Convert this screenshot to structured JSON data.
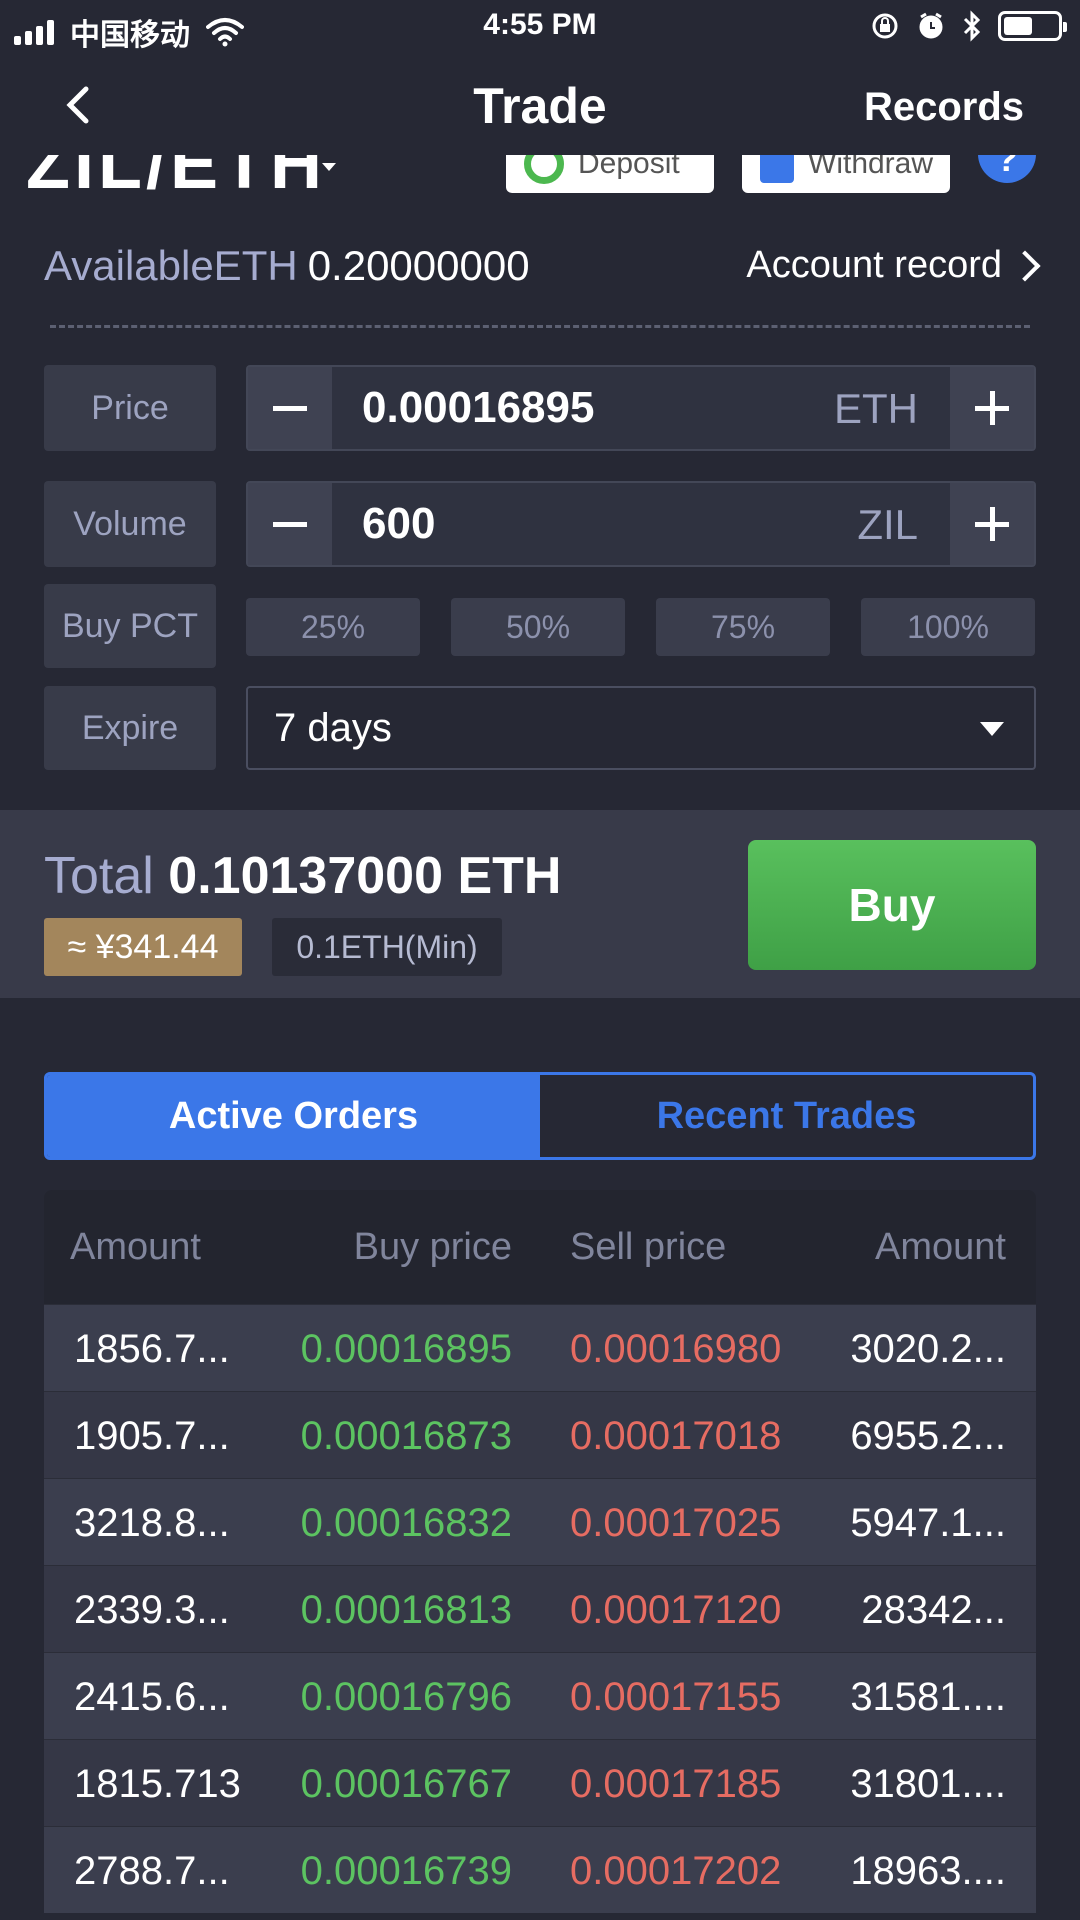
{
  "status_bar": {
    "carrier": "中国移动",
    "time": "4:55 PM"
  },
  "nav": {
    "title": "Trade",
    "records": "Records"
  },
  "pair": {
    "name": "ZIL/ETH",
    "deposit": "Deposit",
    "withdraw": "Withdraw",
    "help": "?"
  },
  "available": {
    "label": "AvailableETH",
    "value": "0.20000000",
    "account_record": "Account record"
  },
  "form": {
    "price": {
      "label": "Price",
      "value": "0.00016895",
      "unit": "ETH"
    },
    "volume": {
      "label": "Volume",
      "value": "600",
      "unit": "ZIL"
    },
    "buy_pct": {
      "label": "Buy PCT",
      "options": [
        "25%",
        "50%",
        "75%",
        "100%"
      ]
    },
    "expire": {
      "label": "Expire",
      "value": "7 days"
    }
  },
  "total": {
    "label": "Total",
    "value": "0.10137000 ETH",
    "cny": "≈ ¥341.44",
    "min": "0.1ETH(Min)",
    "buy": "Buy"
  },
  "tabs": {
    "active": "Active Orders",
    "recent": "Recent Trades"
  },
  "orderbook": {
    "headers": [
      "Amount",
      "Buy price",
      "Sell price",
      "Amount"
    ],
    "rows": [
      [
        "1856.7...",
        "0.00016895",
        "0.00016980",
        "3020.2..."
      ],
      [
        "1905.7...",
        "0.00016873",
        "0.00017018",
        "6955.2..."
      ],
      [
        "3218.8...",
        "0.00016832",
        "0.00017025",
        "5947.1..."
      ],
      [
        "2339.3...",
        "0.00016813",
        "0.00017120",
        "28342..."
      ],
      [
        "2415.6...",
        "0.00016796",
        "0.00017155",
        "31581...."
      ],
      [
        "1815.713",
        "0.00016767",
        "0.00017185",
        "31801...."
      ],
      [
        "2788.7...",
        "0.00016739",
        "0.00017202",
        "18963...."
      ]
    ]
  },
  "colors": {
    "accent": "#3b77e8",
    "buy_green": "#5cc361",
    "sell_red": "#e66c62",
    "background": "#262834"
  }
}
